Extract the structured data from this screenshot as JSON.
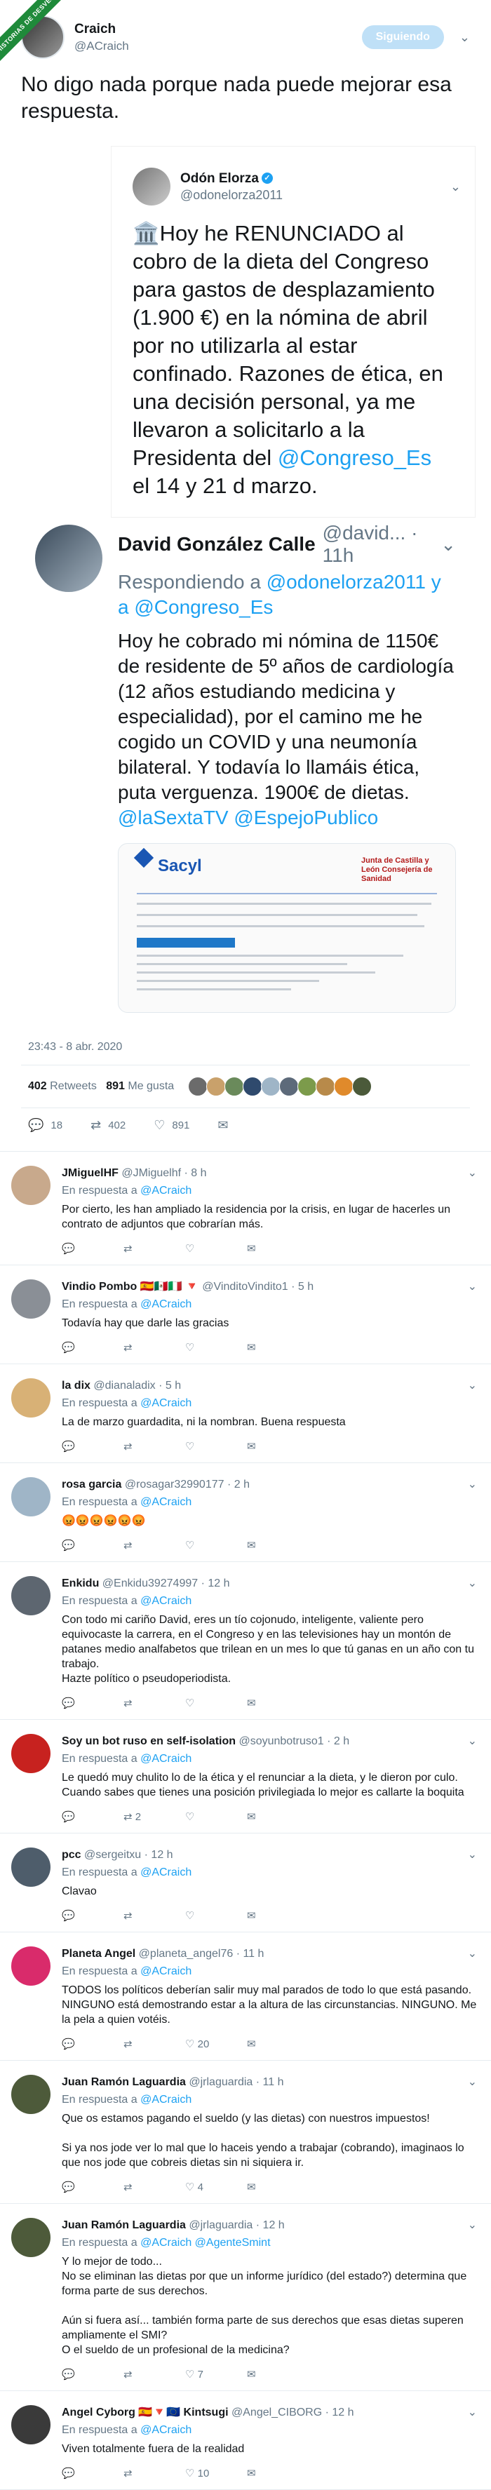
{
  "main": {
    "ribbon": "HISTORIAS DE DESVEL",
    "name": "Craich",
    "handle": "@ACraich",
    "follow": "Siguiendo",
    "text": "No digo nada porque nada puede mejorar esa respuesta."
  },
  "quoted": {
    "name": "Odón Elorza",
    "handle": "@odonelorza2011",
    "text_before": "🏛️Hoy he RENUNCIADO al cobro de la dieta del Congreso para gastos de desplazamiento (1.900 €) en la nómina de abril por no utilizarla al estar confinado. Razones de ética, en una decisión personal, ya me llevaron a solicitarlo a la Presidenta del ",
    "link": "@Congreso_Es",
    "text_after": " el 14 y 21 d marzo."
  },
  "response": {
    "name": "David González Calle",
    "handle": "@david... · 11h",
    "reply_prefix": "Respondiendo a ",
    "reply_to": "@odonelorza2011 y a @Congreso_Es",
    "text": "Hoy he cobrado mi nómina de 1150€ de residente de 5º años de cardiología (12 años estudiando medicina y especialidad), por el camino me he cogido un COVID y una neumonía bilateral. Y todavía lo llamáis ética, puta verguenza. 1900€ de dietas. ",
    "links": "@laSextaTV @EspejoPublico",
    "doc_left": "Sacyl",
    "doc_right": "Junta de Castilla y León Consejería de Sanidad"
  },
  "meta": {
    "time": "23:43 - 8 abr. 2020",
    "retweets_num": "402",
    "retweets_label": "Retweets",
    "likes_num": "891",
    "likes_label": "Me gusta",
    "replies": "18",
    "rts": "402",
    "favs": "891"
  },
  "replies": [
    {
      "name": "JMiguelHF",
      "handle": "@JMiguelhf · 8 h",
      "to": "@ACraich",
      "text": "Por cierto, les han ampliado la residencia por la crisis, en lugar de hacerles un contrato de adjuntos que cobrarían más.",
      "counts": [
        "",
        "",
        ""
      ],
      "color": "#c8a98c"
    },
    {
      "name": "Vindio Pombo 🇪🇸🇲🇽🇮🇹 🔻",
      "handle": "@VinditoVindito1 · 5 h",
      "to": "@ACraich",
      "text": "Todavía hay que darle las gracias",
      "counts": [
        "",
        "",
        ""
      ],
      "color": "#8a8f96"
    },
    {
      "name": "la dix",
      "handle": "@dianaladix · 5 h",
      "to": "@ACraich",
      "text": "La de marzo guardadita, ni la nombran. Buena respuesta",
      "counts": [
        "",
        "",
        ""
      ],
      "color": "#d8b176"
    },
    {
      "name": "rosa garcia",
      "handle": "@rosagar32990177 · 2 h",
      "to": "@ACraich",
      "text": "😡😡😡😡😡😡",
      "counts": [
        "",
        "",
        ""
      ],
      "color": "#9fb5c7"
    },
    {
      "name": "Enkidu",
      "handle": "@Enkidu39274997 · 12 h",
      "to": "@ACraich",
      "text": "Con todo mi cariño David, eres un tío cojonudo, inteligente, valiente pero equivocaste la carrera, en el Congreso y en las televisiones hay un montón de patanes medio analfabetos que trilean en un mes lo que tú ganas en un año con tu trabajo.\nHazte político o pseudoperiodista.",
      "counts": [
        "",
        "",
        ""
      ],
      "color": "#5d6670"
    },
    {
      "name": "Soy un bot ruso en self-isolation",
      "handle": "@soyunbotruso1 · 2 h",
      "to": "@ACraich",
      "text": "Le quedó muy chulito lo de la ética y el renunciar a la dieta, y le dieron por culo. Cuando sabes que tienes una posición privilegiada lo mejor es callarte la boquita",
      "counts": [
        "",
        "2",
        ""
      ],
      "color": "#c7221f"
    },
    {
      "name": "pcc",
      "handle": "@sergeitxu · 12 h",
      "to": "@ACraich",
      "text": "Clavao",
      "counts": [
        "",
        "",
        ""
      ],
      "color": "#4e5d6b"
    },
    {
      "name": "Planeta Angel",
      "handle": "@planeta_angel76 · 11 h",
      "to": "@ACraich",
      "text": "TODOS los políticos deberían salir muy mal parados de todo lo que está pasando. NINGUNO está demostrando estar a la altura de las circunstancias. NINGUNO. Me la pela a quien votéis.",
      "counts": [
        "",
        "",
        "20"
      ],
      "color": "#d92b6b"
    },
    {
      "name": "Juan Ramón Laguardia",
      "handle": "@jrlaguardia · 11 h",
      "to": "@ACraich",
      "text": "Que os estamos pagando el sueldo (y las dietas) con nuestros impuestos!\n\nSi ya nos jode ver lo mal que lo haceis yendo a trabajar (cobrando), imaginaos lo que nos jode que cobreis dietas sin ni siquiera ir.",
      "counts": [
        "",
        "",
        "4"
      ],
      "color": "#4d5a3a"
    },
    {
      "name": "Juan Ramón Laguardia",
      "handle": "@jrlaguardia · 12 h",
      "to": "@ACraich @AgenteSmint",
      "text": "Y lo mejor de todo...\nNo se eliminan las dietas por que un informe jurídico (del estado?) determina que forma parte de sus derechos.\n\nAún si fuera así... también forma parte de sus derechos que esas dietas superen ampliamente el SMI?\nO el sueldo de un profesional de la medicina?",
      "counts": [
        "",
        "",
        "7"
      ],
      "color": "#4d5a3a"
    },
    {
      "name": "Angel Cyborg 🇪🇸🔻🇪🇺 Kintsugi",
      "handle": "@Angel_CIBORG · 12 h",
      "to": "@ACraich",
      "text": "Viven totalmente fuera de la realidad",
      "counts": [
        "",
        "",
        "10"
      ],
      "color": "#3a3a3a"
    }
  ],
  "labels": {
    "reply_prefix": "En respuesta a "
  }
}
